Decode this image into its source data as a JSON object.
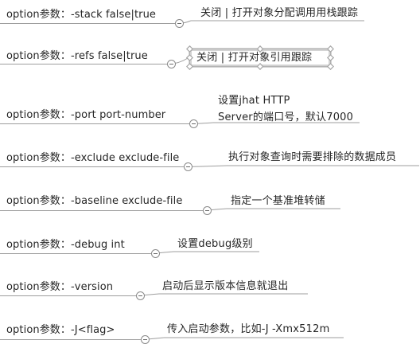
{
  "options": [
    {
      "label": "option参数：-stack false|true",
      "desc": "关闭 | 打开对象分配调用用栈跟踪"
    },
    {
      "label": "option参数：-refs false|true",
      "desc": "关闭 | 打开对象引用跟踪"
    },
    {
      "label": "option参数：-port port-number",
      "desc": "设置jhat HTTP\nServer的端口号，默认7000"
    },
    {
      "label": "option参数：-exclude exclude-file",
      "desc": "执行对象查询时需要排除的数据成员"
    },
    {
      "label": "option参数：-baseline exclude-file",
      "desc": "指定一个基准堆转储"
    },
    {
      "label": "option参数：-debug int",
      "desc": "设置debug级别"
    },
    {
      "label": "option参数：-version",
      "desc": "启动后显示版本信息就退出"
    },
    {
      "label": "option参数：-J<flag>",
      "desc": "传入启动参数，比如-J -Xmx512m"
    }
  ]
}
